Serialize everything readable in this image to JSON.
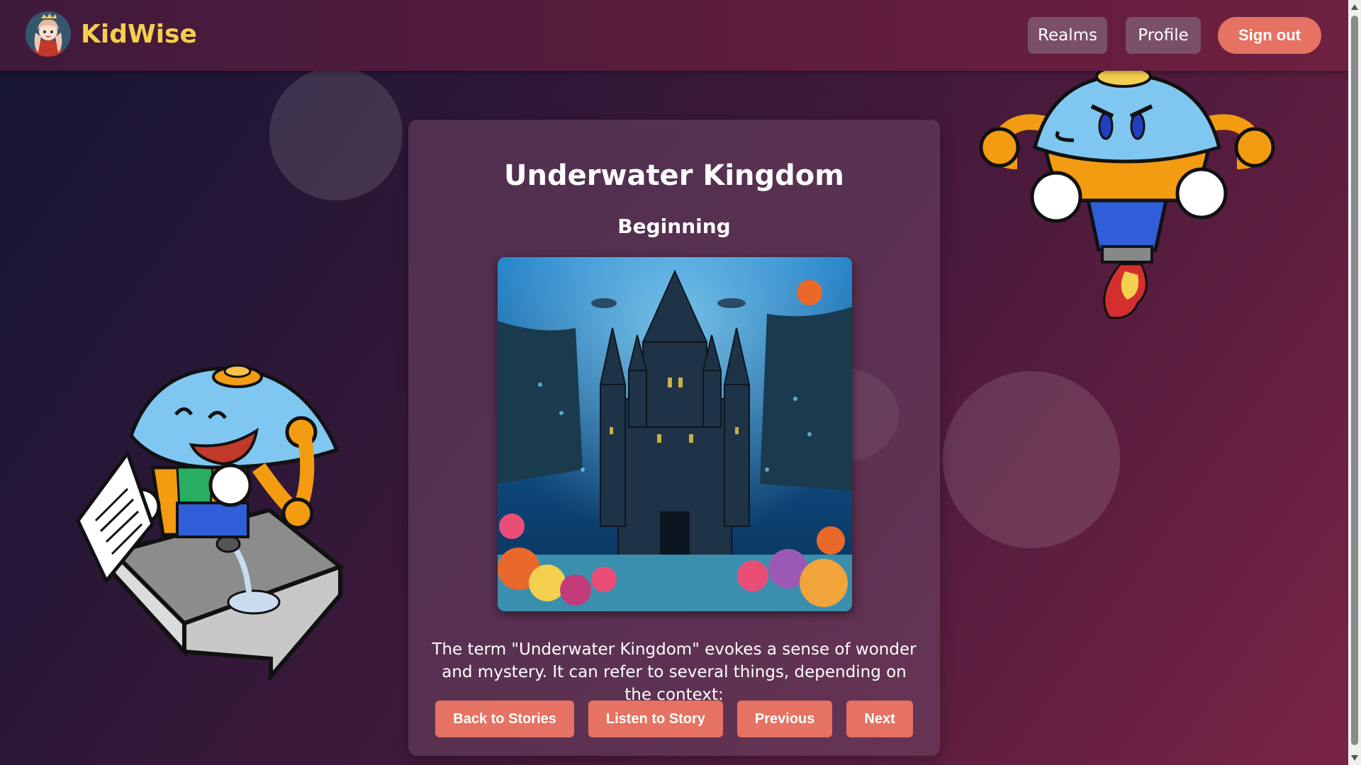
{
  "nav": {
    "brand": "KidWise",
    "realms": "Realms",
    "profile": "Profile",
    "sign_out": "Sign out"
  },
  "story": {
    "title": "Underwater Kingdom",
    "chapter": "Beginning",
    "text": "The term \"Underwater Kingdom\" evokes a sense of wonder and mystery. It can refer to several things, depending on the context:"
  },
  "actions": {
    "back": "Back to Stories",
    "listen": "Listen to Story",
    "previous": "Previous",
    "next": "Next"
  },
  "colors": {
    "brand_yellow": "#f5cf4e",
    "accent_coral": "#e57262",
    "nav_button": "#7a4f69"
  }
}
